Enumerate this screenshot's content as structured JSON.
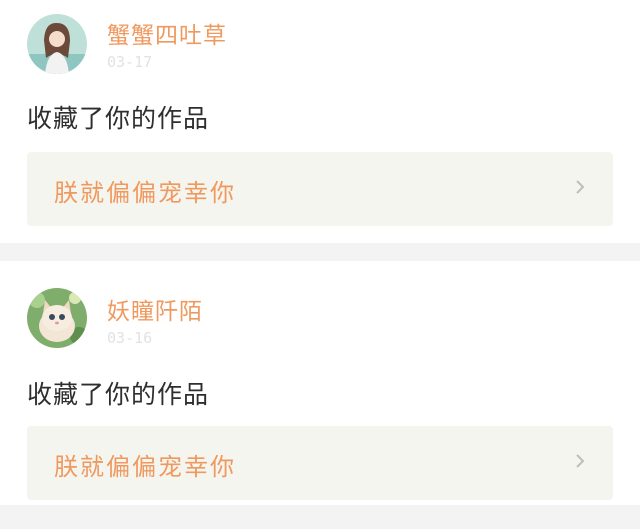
{
  "comments": [
    {
      "username": "蟹蟹四吐草",
      "date": "03-17",
      "message": "收藏了你的作品",
      "work_title": "朕就偏偏宠幸你",
      "avatar_icon": "user-avatar-girl-photo",
      "chevron_icon": "chevron-right-icon"
    },
    {
      "username": "妖瞳阡陌",
      "date": "03-16",
      "message": "收藏了你的作品",
      "work_title": "朕就偏偏宠幸你",
      "avatar_icon": "user-avatar-kitten-photo",
      "chevron_icon": "chevron-right-icon"
    }
  ],
  "colors": {
    "accent": "#f0995f",
    "link_bg": "#f5f5ef",
    "separator": "#f3f3f3",
    "date_text": "#e2e2e2"
  }
}
